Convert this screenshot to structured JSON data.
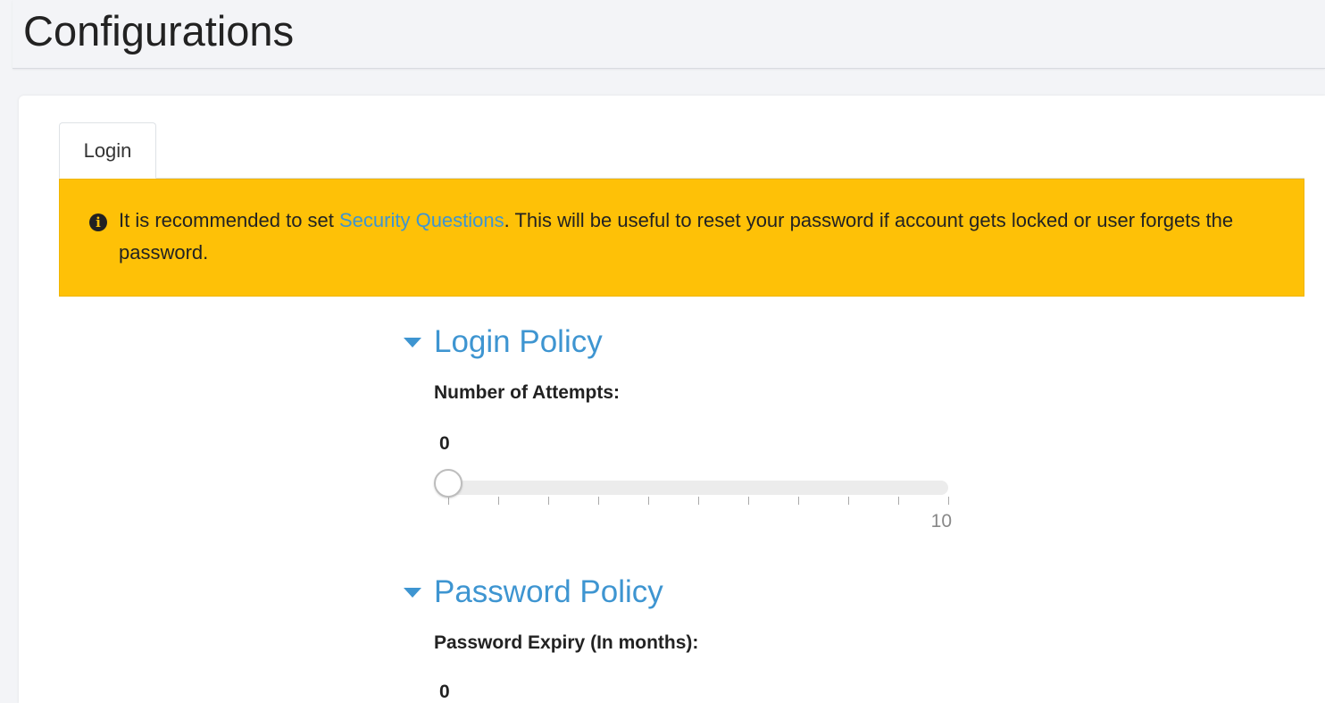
{
  "header": {
    "title": "Configurations"
  },
  "tabs": [
    {
      "label": "Login",
      "active": true
    }
  ],
  "alert": {
    "icon": "info-circle-icon",
    "text_before": "It is recommended to set ",
    "link_text": "Security Questions",
    "text_after": ". This will be useful to reset your password if account gets locked or user forgets the password.",
    "background": "#fec107"
  },
  "login_policy": {
    "title": "Login Policy",
    "attempts": {
      "label": "Number of Attempts:",
      "value": 0,
      "min": 0,
      "max": 10,
      "max_label": "10"
    }
  },
  "password_policy": {
    "title": "Password Policy",
    "expiry": {
      "label": "Password Expiry (In months):",
      "value": 0
    }
  },
  "colors": {
    "accent": "#3e95d1",
    "alert": "#fec107",
    "text": "#222222"
  }
}
